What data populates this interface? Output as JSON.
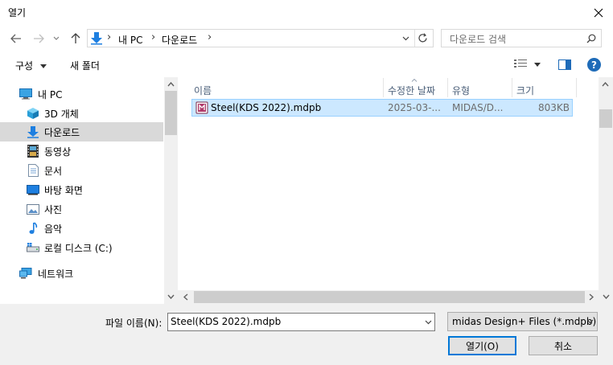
{
  "window": {
    "title": "열기"
  },
  "address": {
    "breadcrumb": [
      "내 PC",
      "다운로드"
    ]
  },
  "search": {
    "placeholder": "다운로드 검색"
  },
  "toolbar": {
    "organize_label": "구성",
    "new_folder_label": "새 폴더"
  },
  "nav": {
    "items": [
      {
        "label": "내 PC",
        "icon": "computer-icon"
      },
      {
        "label": "3D 개체",
        "icon": "cube-3d-icon"
      },
      {
        "label": "다운로드",
        "icon": "download-arrow-icon",
        "selected": true
      },
      {
        "label": "동영상",
        "icon": "film-icon"
      },
      {
        "label": "문서",
        "icon": "document-icon"
      },
      {
        "label": "바탕 화면",
        "icon": "desktop-icon"
      },
      {
        "label": "사진",
        "icon": "picture-icon"
      },
      {
        "label": "음악",
        "icon": "music-note-icon"
      },
      {
        "label": "로컬 디스크 (C:)",
        "icon": "drive-icon"
      },
      {
        "label": "네트워크",
        "icon": "network-icon"
      }
    ]
  },
  "files": {
    "columns": [
      "이름",
      "수정한 날짜",
      "유형",
      "크기"
    ],
    "rows": [
      {
        "name": "Steel(KDS 2022).mdpb",
        "modified": "2025-03-...",
        "type": "MIDAS/D...",
        "size": "803KB",
        "selected": true
      }
    ]
  },
  "bottom": {
    "filename_label": "파일 이름(N):",
    "filename_value": "Steel(KDS 2022).mdpb",
    "filter_value": "midas Design+ Files (*.mdpb)",
    "open_label": "열기(O)",
    "cancel_label": "취소"
  },
  "colors": {
    "accent": "#0078d7",
    "selection": "#cce8ff",
    "help": "#1e6bb8"
  }
}
